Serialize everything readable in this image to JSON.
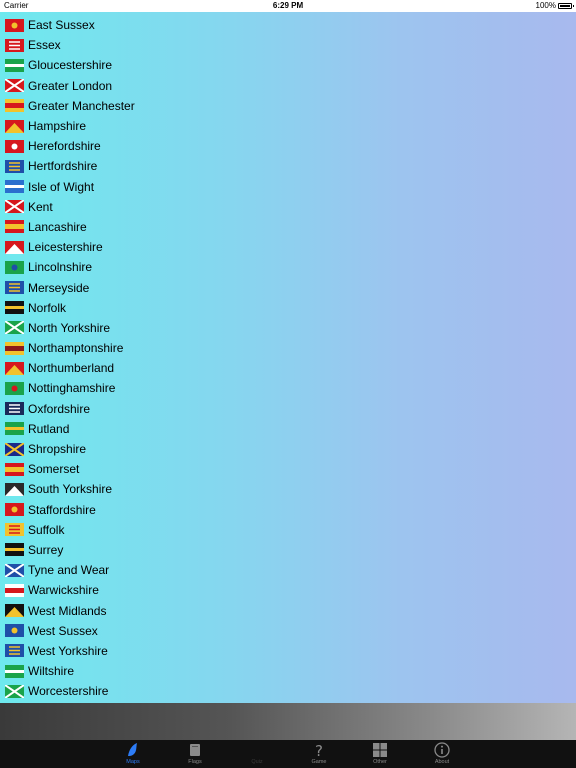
{
  "status_bar": {
    "carrier": "Carrier",
    "time": "6:29 PM",
    "battery": "100%"
  },
  "counties": [
    {
      "name": "East Sussex",
      "flag": "east-sussex-flag",
      "colors": [
        "#d6171d",
        "#f2c22c"
      ]
    },
    {
      "name": "Essex",
      "flag": "essex-flag",
      "colors": [
        "#d6171d",
        "#ffffff"
      ]
    },
    {
      "name": "Gloucestershire",
      "flag": "gloucestershire-flag",
      "colors": [
        "#1aa34a",
        "#ffffff"
      ]
    },
    {
      "name": "Greater London",
      "flag": "greater-london-flag",
      "colors": [
        "#d6171d",
        "#ffffff"
      ]
    },
    {
      "name": "Greater Manchester",
      "flag": "greater-manchester-flag",
      "colors": [
        "#d6171d",
        "#f2c22c"
      ]
    },
    {
      "name": "Hampshire",
      "flag": "hampshire-flag",
      "colors": [
        "#d6171d",
        "#f2c22c"
      ]
    },
    {
      "name": "Herefordshire",
      "flag": "herefordshire-flag",
      "colors": [
        "#d6171d",
        "#ffffff"
      ]
    },
    {
      "name": "Hertfordshire",
      "flag": "hertfordshire-flag",
      "colors": [
        "#1f4fa8",
        "#f2c22c"
      ]
    },
    {
      "name": "Isle of Wight",
      "flag": "isle-of-wight-flag",
      "colors": [
        "#2a6fce",
        "#ffffff"
      ]
    },
    {
      "name": "Kent",
      "flag": "kent-flag",
      "colors": [
        "#d6171d",
        "#ffffff"
      ]
    },
    {
      "name": "Lancashire",
      "flag": "lancashire-flag",
      "colors": [
        "#f2c22c",
        "#d6171d"
      ]
    },
    {
      "name": "Leicestershire",
      "flag": "leicestershire-flag",
      "colors": [
        "#d6171d",
        "#ffffff"
      ]
    },
    {
      "name": "Lincolnshire",
      "flag": "lincolnshire-flag",
      "colors": [
        "#1aa34a",
        "#1f4fa8"
      ]
    },
    {
      "name": "Merseyside",
      "flag": "merseyside-flag",
      "colors": [
        "#1f4fa8",
        "#f2c22c"
      ]
    },
    {
      "name": "Norfolk",
      "flag": "norfolk-flag",
      "colors": [
        "#111111",
        "#f2c22c"
      ]
    },
    {
      "name": "North Yorkshire",
      "flag": "north-yorkshire-flag",
      "colors": [
        "#1aa34a",
        "#ffffff"
      ]
    },
    {
      "name": "Northamptonshire",
      "flag": "northamptonshire-flag",
      "colors": [
        "#8b1a1a",
        "#f2c22c"
      ]
    },
    {
      "name": "Northumberland",
      "flag": "northumberland-flag",
      "colors": [
        "#d6171d",
        "#f2c22c"
      ]
    },
    {
      "name": "Nottinghamshire",
      "flag": "nottinghamshire-flag",
      "colors": [
        "#1aa34a",
        "#d6171d"
      ]
    },
    {
      "name": "Oxfordshire",
      "flag": "oxfordshire-flag",
      "colors": [
        "#1a2a5a",
        "#ffffff"
      ]
    },
    {
      "name": "Rutland",
      "flag": "rutland-flag",
      "colors": [
        "#1aa34a",
        "#f2c22c"
      ]
    },
    {
      "name": "Shropshire",
      "flag": "shropshire-flag",
      "colors": [
        "#1a2a8a",
        "#f2c22c"
      ]
    },
    {
      "name": "Somerset",
      "flag": "somerset-flag",
      "colors": [
        "#f2c22c",
        "#d6171d"
      ]
    },
    {
      "name": "South Yorkshire",
      "flag": "south-yorkshire-flag",
      "colors": [
        "#2a2a2a",
        "#ffffff"
      ]
    },
    {
      "name": "Staffordshire",
      "flag": "staffordshire-flag",
      "colors": [
        "#d6171d",
        "#f2c22c"
      ]
    },
    {
      "name": "Suffolk",
      "flag": "suffolk-flag",
      "colors": [
        "#f2c22c",
        "#d6171d"
      ]
    },
    {
      "name": "Surrey",
      "flag": "surrey-flag",
      "colors": [
        "#111111",
        "#f2c22c"
      ]
    },
    {
      "name": "Tyne and Wear",
      "flag": "tyne-and-wear-flag",
      "colors": [
        "#1f4fa8",
        "#ffffff"
      ]
    },
    {
      "name": "Warwickshire",
      "flag": "warwickshire-flag",
      "colors": [
        "#d6171d",
        "#ffffff"
      ]
    },
    {
      "name": "West Midlands",
      "flag": "west-midlands-flag",
      "colors": [
        "#111111",
        "#f2c22c"
      ]
    },
    {
      "name": "West Sussex",
      "flag": "west-sussex-flag",
      "colors": [
        "#1f4fa8",
        "#f2c22c"
      ]
    },
    {
      "name": "West Yorkshire",
      "flag": "west-yorkshire-flag",
      "colors": [
        "#1f4fa8",
        "#f2c22c"
      ]
    },
    {
      "name": "Wiltshire",
      "flag": "wiltshire-flag",
      "colors": [
        "#1aa34a",
        "#ffffff"
      ]
    },
    {
      "name": "Worcestershire",
      "flag": "worcestershire-flag",
      "colors": [
        "#1aa34a",
        "#ffffff"
      ]
    }
  ],
  "tabs": [
    {
      "label": "Maps",
      "icon": "bird-icon",
      "state": "active"
    },
    {
      "label": "Flags",
      "icon": "book-icon",
      "state": "normal"
    },
    {
      "label": "Quiz",
      "icon": "",
      "state": "disabled"
    },
    {
      "label": "Game",
      "icon": "question-mark-icon",
      "state": "normal"
    },
    {
      "label": "Other",
      "icon": "grid-icon",
      "state": "normal"
    },
    {
      "label": "About",
      "icon": "info-icon",
      "state": "normal"
    }
  ],
  "colors": {
    "active_tab": "#2d7cf6",
    "tab_bar": "#111111",
    "inactive_label": "#8a8a8a"
  }
}
